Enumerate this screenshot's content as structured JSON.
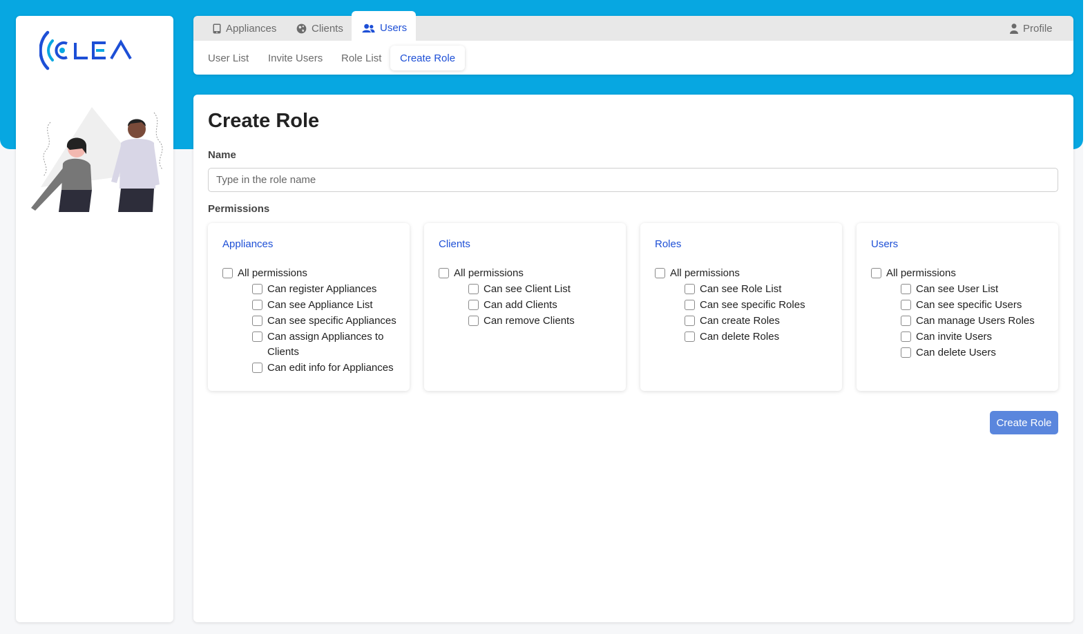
{
  "brand": {
    "logo_text": "CLEA",
    "accent": "#1d4fd6",
    "banner_color": "#07a7e1"
  },
  "tabs": [
    {
      "label": "Appliances",
      "icon": "tablet-icon",
      "active": false
    },
    {
      "label": "Clients",
      "icon": "globe-icon",
      "active": false
    },
    {
      "label": "Users",
      "icon": "users-icon",
      "active": true
    }
  ],
  "profile": {
    "label": "Profile",
    "icon": "user-icon"
  },
  "subtabs": [
    {
      "label": "User List",
      "active": false
    },
    {
      "label": "Invite Users",
      "active": false
    },
    {
      "label": "Role List",
      "active": false
    },
    {
      "label": "Create Role",
      "active": true
    }
  ],
  "form": {
    "title": "Create Role",
    "name_label": "Name",
    "name_placeholder": "Type in the role name",
    "name_value": "",
    "permissions_label": "Permissions",
    "submit_label": "Create Role"
  },
  "permission_groups": [
    {
      "title": "Appliances",
      "all_label": "All permissions",
      "items": [
        "Can register Appliances",
        "Can see Appliance List",
        "Can see specific Appliances",
        "Can assign Appliances to Clients",
        "Can edit info for Appliances"
      ]
    },
    {
      "title": "Clients",
      "all_label": "All permissions",
      "items": [
        "Can see Client List",
        "Can add Clients",
        "Can remove Clients"
      ]
    },
    {
      "title": "Roles",
      "all_label": "All permissions",
      "items": [
        "Can see Role List",
        "Can see specific Roles",
        "Can create Roles",
        "Can delete Roles"
      ]
    },
    {
      "title": "Users",
      "all_label": "All permissions",
      "items": [
        "Can see User List",
        "Can see specific Users",
        "Can manage Users Roles",
        "Can invite Users",
        "Can delete Users"
      ]
    }
  ]
}
